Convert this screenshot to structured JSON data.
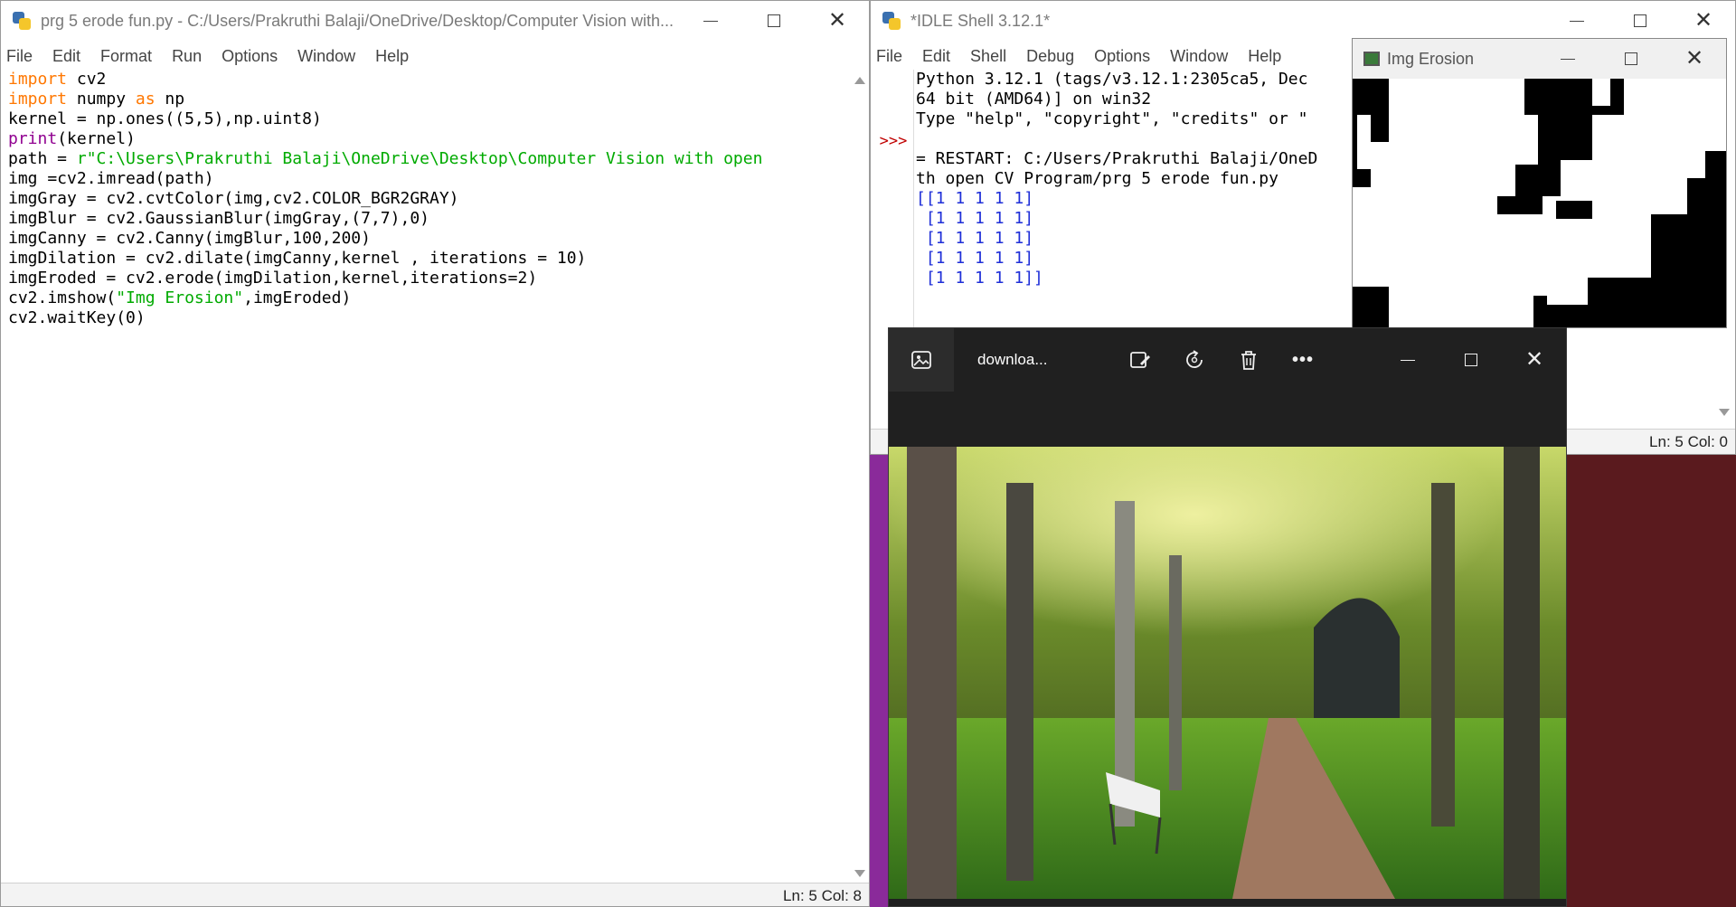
{
  "editor_window": {
    "title": "prg 5 erode fun.py - C:/Users/Prakruthi Balaji/OneDrive/Desktop/Computer Vision with...",
    "menu": [
      "File",
      "Edit",
      "Format",
      "Run",
      "Options",
      "Window",
      "Help"
    ],
    "code": [
      [
        {
          "t": "import",
          "c": "kw"
        },
        {
          "t": " cv2"
        }
      ],
      [
        {
          "t": "import",
          "c": "kw"
        },
        {
          "t": " numpy "
        },
        {
          "t": "as",
          "c": "kw"
        },
        {
          "t": " np"
        }
      ],
      [
        {
          "t": "kernel = np.ones((5,5),np.uint8)"
        }
      ],
      [
        {
          "t": "print",
          "c": "bi"
        },
        {
          "t": "(kernel)"
        }
      ],
      [
        {
          "t": "path = "
        },
        {
          "t": "r\"C:\\Users\\Prakruthi Balaji\\OneDrive\\Desktop\\Computer Vision with open",
          "c": "st"
        }
      ],
      [
        {
          "t": "img =cv2.imread(path)"
        }
      ],
      [
        {
          "t": "imgGray = cv2.cvtColor(img,cv2.COLOR_BGR2GRAY)"
        }
      ],
      [
        {
          "t": "imgBlur = cv2.GaussianBlur(imgGray,(7,7),0)"
        }
      ],
      [
        {
          "t": "imgCanny = cv2.Canny(imgBlur,100,200)"
        }
      ],
      [
        {
          "t": "imgDilation = cv2.dilate(imgCanny,kernel , iterations = 10)"
        }
      ],
      [
        {
          "t": "imgEroded = cv2.erode(imgDilation,kernel,iterations=2)"
        }
      ],
      [
        {
          "t": "cv2.imshow("
        },
        {
          "t": "\"Img Erosion\"",
          "c": "st"
        },
        {
          "t": ",imgEroded)"
        }
      ],
      [
        {
          "t": "cv2.waitKey(0)"
        }
      ]
    ],
    "status": "Ln: 5   Col: 8"
  },
  "shell_window": {
    "title": "*IDLE Shell 3.12.1*",
    "menu": [
      "File",
      "Edit",
      "Shell",
      "Debug",
      "Options",
      "Window",
      "Help"
    ],
    "prompt": ">>>",
    "lines": [
      {
        "t": "Python 3.12.1 (tags/v3.12.1:2305ca5, Dec",
        "c": ""
      },
      {
        "t": "64 bit (AMD64)] on win32",
        "c": ""
      },
      {
        "t": "Type \"help\", \"copyright\", \"credits\" or \"",
        "c": ""
      },
      {
        "t": "",
        "c": ""
      },
      {
        "t": "= RESTART: C:/Users/Prakruthi Balaji/OneD",
        "c": ""
      },
      {
        "t": "th open CV Program/prg 5 erode fun.py",
        "c": ""
      },
      {
        "t": "[[1 1 1 1 1]",
        "c": "out"
      },
      {
        "t": " [1 1 1 1 1]",
        "c": "out"
      },
      {
        "t": " [1 1 1 1 1]",
        "c": "out"
      },
      {
        "t": " [1 1 1 1 1]",
        "c": "out"
      },
      {
        "t": " [1 1 1 1 1]]",
        "c": "out"
      }
    ],
    "status": "Ln: 5   Col: 0"
  },
  "erosion_window": {
    "title": "Img Erosion"
  },
  "photos_window": {
    "filename": "downloa...",
    "more": "•••"
  },
  "icons": [
    "python-icon",
    "minimize-icon",
    "maximize-icon",
    "close-icon",
    "gallery-icon",
    "edit-image-icon",
    "rotate-icon",
    "delete-icon",
    "more-icon"
  ]
}
